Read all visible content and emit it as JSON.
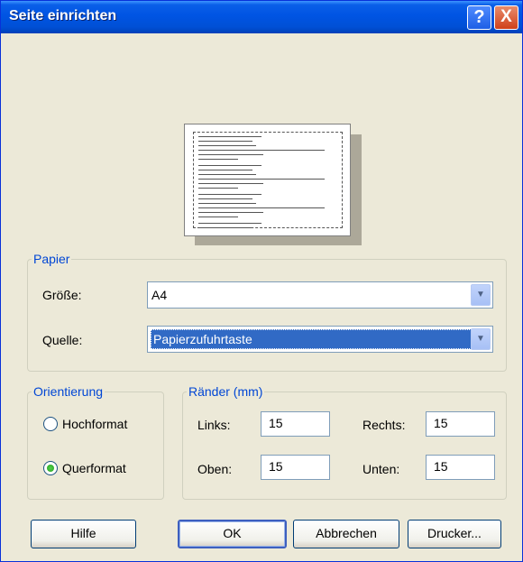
{
  "window": {
    "title": "Seite einrichten"
  },
  "titlebar": {
    "help_glyph": "?",
    "close_glyph": "X"
  },
  "papier": {
    "legend": "Papier",
    "groesse_label": "Größe:",
    "groesse_value": "A4",
    "quelle_label": "Quelle:",
    "quelle_value": "Papierzufuhrtaste"
  },
  "orientierung": {
    "legend": "Orientierung",
    "options": [
      {
        "label": "Hochformat",
        "checked": false
      },
      {
        "label": "Querformat",
        "checked": true
      }
    ]
  },
  "raender": {
    "legend": "Ränder (mm)",
    "links_label": "Links:",
    "links_value": "15",
    "rechts_label": "Rechts:",
    "rechts_value": "15",
    "oben_label": "Oben:",
    "oben_value": "15",
    "unten_label": "Unten:",
    "unten_value": "15"
  },
  "buttons": {
    "hilfe": "Hilfe",
    "ok": "OK",
    "abbrechen": "Abbrechen",
    "drucker": "Drucker..."
  },
  "icons": {
    "dropdown_arrow": "chevron-down-icon"
  },
  "colors": {
    "titlebar": "#0054e3",
    "legend": "#0046d5",
    "selection": "#316ac5",
    "dialog_bg": "#ece9d8"
  }
}
